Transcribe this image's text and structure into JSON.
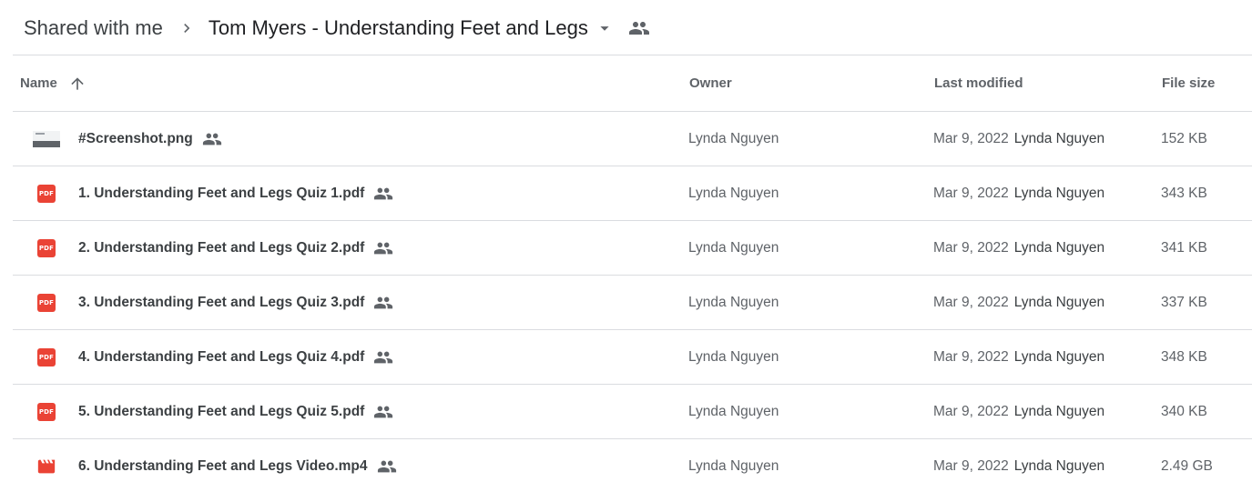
{
  "breadcrumb": {
    "root": "Shared with me",
    "current": "Tom Myers - Understanding Feet and Legs"
  },
  "icons": {
    "chevron": "chevron-right-icon",
    "dropdown": "arrow-drop-down-icon",
    "shared": "people-icon",
    "sort": "arrow-up-icon"
  },
  "colors": {
    "pdf": "#ea4335",
    "video": "#ea4335",
    "text_primary": "#3c4043",
    "text_secondary": "#5f6368",
    "divider": "#dadce0"
  },
  "columns": {
    "name": "Name",
    "owner": "Owner",
    "modified": "Last modified",
    "size": "File size"
  },
  "files": [
    {
      "type": "image",
      "name": "#Screenshot.png",
      "owner": "Lynda Nguyen",
      "modified_date": "Mar 9, 2022",
      "modified_by": "Lynda Nguyen",
      "size": "152 KB"
    },
    {
      "type": "pdf",
      "name": "1. Understanding Feet and Legs Quiz 1.pdf",
      "owner": "Lynda Nguyen",
      "modified_date": "Mar 9, 2022",
      "modified_by": "Lynda Nguyen",
      "size": "343 KB"
    },
    {
      "type": "pdf",
      "name": "2. Understanding Feet and Legs Quiz 2.pdf",
      "owner": "Lynda Nguyen",
      "modified_date": "Mar 9, 2022",
      "modified_by": "Lynda Nguyen",
      "size": "341 KB"
    },
    {
      "type": "pdf",
      "name": "3. Understanding Feet and Legs Quiz 3.pdf",
      "owner": "Lynda Nguyen",
      "modified_date": "Mar 9, 2022",
      "modified_by": "Lynda Nguyen",
      "size": "337 KB"
    },
    {
      "type": "pdf",
      "name": "4. Understanding Feet and Legs Quiz 4.pdf",
      "owner": "Lynda Nguyen",
      "modified_date": "Mar 9, 2022",
      "modified_by": "Lynda Nguyen",
      "size": "348 KB"
    },
    {
      "type": "pdf",
      "name": "5. Understanding Feet and Legs Quiz 5.pdf",
      "owner": "Lynda Nguyen",
      "modified_date": "Mar 9, 2022",
      "modified_by": "Lynda Nguyen",
      "size": "340 KB"
    },
    {
      "type": "video",
      "name": "6. Understanding Feet and Legs Video.mp4",
      "owner": "Lynda Nguyen",
      "modified_date": "Mar 9, 2022",
      "modified_by": "Lynda Nguyen",
      "size": "2.49 GB"
    }
  ],
  "pdf_badge_text": "PDF"
}
